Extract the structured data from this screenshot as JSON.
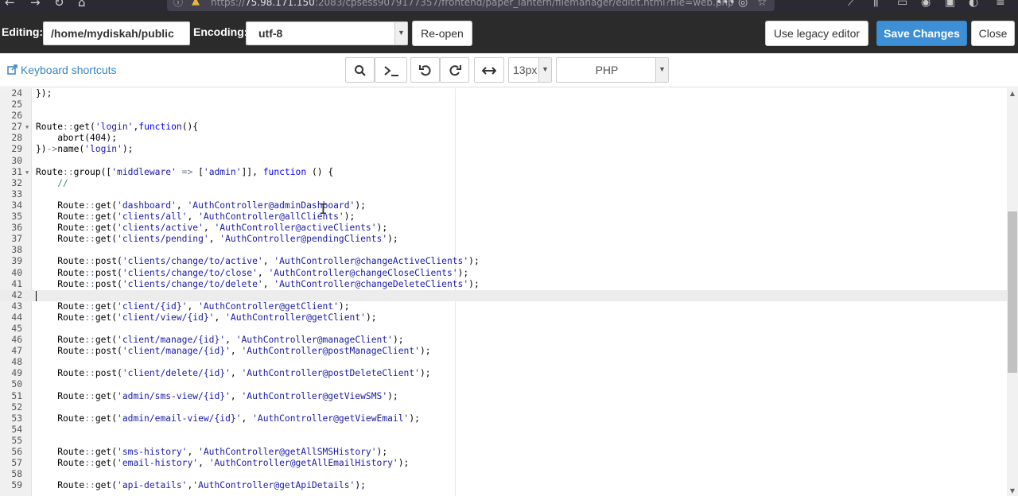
{
  "browser": {
    "url_prefix": "https://",
    "url_host": "75.98.171.150",
    "url_rest": ":2083/cpsess9079177357/frontend/paper_lantern/filemanager/editit.html?file=web.php"
  },
  "header": {
    "editing_label": "Editing:",
    "path": "/home/mydiskah/public",
    "encoding_label": "Encoding:",
    "encoding_value": "utf-8",
    "reopen_label": "Re-open",
    "legacy_label": "Use legacy editor",
    "save_label": "Save Changes",
    "close_label": "Close"
  },
  "toolbar": {
    "shortcuts_label": "Keyboard shortcuts",
    "font_size": "13px",
    "mode": "PHP"
  },
  "icons": {
    "search": "search-icon",
    "terminal": "terminal-icon",
    "undo": "undo-icon",
    "redo": "redo-icon",
    "wrap": "wrap-icon",
    "external": "external-link-icon"
  },
  "colors": {
    "primary": "#3d8fd6",
    "header_bg": "#2b2b2b",
    "link": "#3a84c6",
    "string": "#1a1aa6",
    "keyword": "#0000ff",
    "operator": "#687687",
    "comment": "#4c886b"
  },
  "code": [
    {
      "n": "24",
      "fold": false,
      "text": "});"
    },
    {
      "n": "25",
      "fold": false,
      "text": ""
    },
    {
      "n": "26",
      "fold": false,
      "text": ""
    },
    {
      "n": "27",
      "fold": true,
      "text": "Route::get('login',function(){"
    },
    {
      "n": "28",
      "fold": false,
      "text": "    abort(404);"
    },
    {
      "n": "29",
      "fold": false,
      "text": "})->name('login');"
    },
    {
      "n": "30",
      "fold": false,
      "text": ""
    },
    {
      "n": "31",
      "fold": true,
      "text": "Route::group(['middleware' => ['admin']], function () {"
    },
    {
      "n": "32",
      "fold": false,
      "text": "    //"
    },
    {
      "n": "33",
      "fold": false,
      "text": ""
    },
    {
      "n": "34",
      "fold": false,
      "text": "    Route::get('dashboard', 'AuthController@adminDashboard');"
    },
    {
      "n": "35",
      "fold": false,
      "text": "    Route::get('clients/all', 'AuthController@allClients');"
    },
    {
      "n": "36",
      "fold": false,
      "text": "    Route::get('clients/active', 'AuthController@activeClients');"
    },
    {
      "n": "37",
      "fold": false,
      "text": "    Route::get('clients/pending', 'AuthController@pendingClients');"
    },
    {
      "n": "38",
      "fold": false,
      "text": ""
    },
    {
      "n": "39",
      "fold": false,
      "text": "    Route::post('clients/change/to/active', 'AuthController@changeActiveClients');"
    },
    {
      "n": "40",
      "fold": false,
      "text": "    Route::post('clients/change/to/close', 'AuthController@changeCloseClients');"
    },
    {
      "n": "41",
      "fold": false,
      "text": "    Route::post('clients/change/to/delete', 'AuthController@changeDeleteClients');"
    },
    {
      "n": "42",
      "fold": false,
      "text": "",
      "active": true
    },
    {
      "n": "43",
      "fold": false,
      "text": "    Route::get('client/{id}', 'AuthController@getClient');"
    },
    {
      "n": "44",
      "fold": false,
      "text": "    Route::get('client/view/{id}', 'AuthController@getClient');"
    },
    {
      "n": "45",
      "fold": false,
      "text": ""
    },
    {
      "n": "46",
      "fold": false,
      "text": "    Route::get('client/manage/{id}', 'AuthController@manageClient');"
    },
    {
      "n": "47",
      "fold": false,
      "text": "    Route::post('client/manage/{id}', 'AuthController@postManageClient');"
    },
    {
      "n": "48",
      "fold": false,
      "text": ""
    },
    {
      "n": "49",
      "fold": false,
      "text": "    Route::post('client/delete/{id}', 'AuthController@postDeleteClient');"
    },
    {
      "n": "50",
      "fold": false,
      "text": ""
    },
    {
      "n": "51",
      "fold": false,
      "text": "    Route::get('admin/sms-view/{id}', 'AuthController@getViewSMS');"
    },
    {
      "n": "52",
      "fold": false,
      "text": ""
    },
    {
      "n": "53",
      "fold": false,
      "text": "    Route::get('admin/email-view/{id}', 'AuthController@getViewEmail');"
    },
    {
      "n": "54",
      "fold": false,
      "text": ""
    },
    {
      "n": "55",
      "fold": false,
      "text": ""
    },
    {
      "n": "56",
      "fold": false,
      "text": "    Route::get('sms-history', 'AuthController@getAllSMSHistory');"
    },
    {
      "n": "57",
      "fold": false,
      "text": "    Route::get('email-history', 'AuthController@getAllEmailHistory');"
    },
    {
      "n": "58",
      "fold": false,
      "text": ""
    },
    {
      "n": "59",
      "fold": false,
      "text": "    Route::get('api-details','AuthController@getApiDetails');"
    }
  ]
}
